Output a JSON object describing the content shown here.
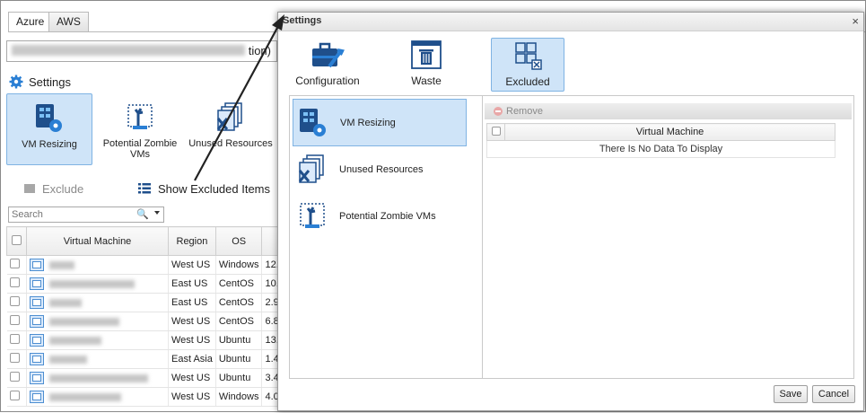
{
  "tabs": [
    {
      "label": "Azure",
      "active": true
    },
    {
      "label": "AWS",
      "active": false
    }
  ],
  "subscription": {
    "suffix": "tion)"
  },
  "settings_link": {
    "label": "Settings"
  },
  "big_buttons": [
    {
      "label": "VM Resizing",
      "selected": true,
      "icon": "vm-resizing-icon"
    },
    {
      "label": "Potential Zombie VMs",
      "icon": "zombie-vm-icon"
    },
    {
      "label": "Unused Resources",
      "icon": "unused-resources-icon"
    }
  ],
  "actions": {
    "exclude": "Exclude",
    "show_excluded": "Show Excluded Items"
  },
  "search": {
    "placeholder": "Search"
  },
  "grid": {
    "headers": [
      "Virtual Machine",
      "Region",
      "OS"
    ],
    "rows": [
      {
        "region": "West US",
        "os": "Windows",
        "size": "12."
      },
      {
        "region": "East US",
        "os": "CentOS",
        "size": "10."
      },
      {
        "region": "East US",
        "os": "CentOS",
        "size": "2.9"
      },
      {
        "region": "West US",
        "os": "CentOS",
        "size": "6.8"
      },
      {
        "region": "West US",
        "os": "Ubuntu",
        "size": "13."
      },
      {
        "region": "East Asia",
        "os": "Ubuntu",
        "size": "1.4"
      },
      {
        "region": "West US",
        "os": "Ubuntu",
        "size": "3.4"
      },
      {
        "region": "West US",
        "os": "Windows",
        "size": "4.0"
      }
    ]
  },
  "dialog": {
    "title": "Settings",
    "close": "×",
    "top_buttons": [
      {
        "label": "Configuration",
        "icon": "configuration-icon"
      },
      {
        "label": "Waste",
        "icon": "waste-icon"
      },
      {
        "label": "Excluded",
        "icon": "excluded-icon",
        "selected": true
      }
    ],
    "left_items": [
      {
        "label": "VM Resizing",
        "selected": true
      },
      {
        "label": "Unused Resources"
      },
      {
        "label": "Potential Zombie VMs"
      }
    ],
    "remove_label": "Remove",
    "grid_header": "Virtual Machine",
    "empty_text": "There Is No Data To Display",
    "save": "Save",
    "cancel": "Cancel"
  },
  "colors": {
    "accent": "#2a7fd4",
    "selected_bg": "#cfe4f8",
    "selected_border": "#7fb3e3"
  }
}
